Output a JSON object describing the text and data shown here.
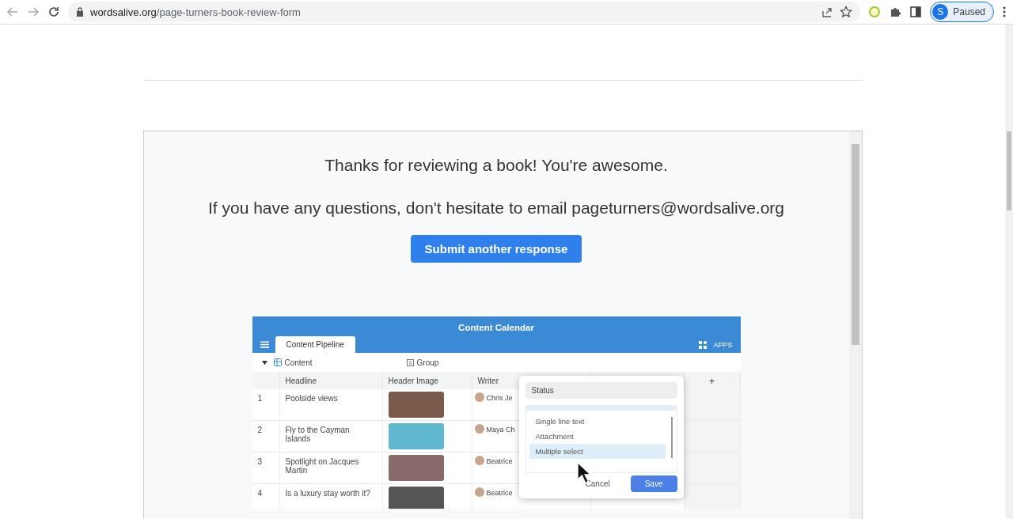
{
  "browser": {
    "url_domain": "wordsalive.org",
    "url_path": "/page-turners-book-review-form",
    "profile_initial": "S",
    "profile_status": "Paused"
  },
  "confirmation": {
    "message": "Thanks for reviewing a book! You're awesome.",
    "contact": "If you have any questions, don't hesitate to email pageturners@wordsalive.org",
    "button": "Submit another response"
  },
  "embedded_app": {
    "title": "Content Calendar",
    "tabs": [
      {
        "label": "Content Pipeline",
        "selected": true
      }
    ],
    "apps_label": "APPS",
    "table_name": "Content",
    "group_label": "Group",
    "columns": [
      "Headline",
      "Header Image",
      "Writer"
    ],
    "add_column": "+",
    "rows": [
      {
        "number": "1",
        "headline": "Poolside views",
        "writer": "Chris Je"
      },
      {
        "number": "2",
        "headline": "Fly to the Cayman Islands",
        "writer": "Maya Ch"
      },
      {
        "number": "3",
        "headline": "Spotlight on Jacques Martin",
        "writer": "Beatrice"
      },
      {
        "number": "4",
        "headline": "Is a luxury stay worth it?",
        "writer": "Beatrice"
      }
    ],
    "field_popup": {
      "name_value": "Status",
      "options": [
        {
          "label": "Single line text",
          "selected": false
        },
        {
          "label": "Attachment",
          "selected": false
        },
        {
          "label": "Multiple select",
          "selected": true
        }
      ],
      "cancel": "Cancel",
      "save": "Save"
    }
  }
}
